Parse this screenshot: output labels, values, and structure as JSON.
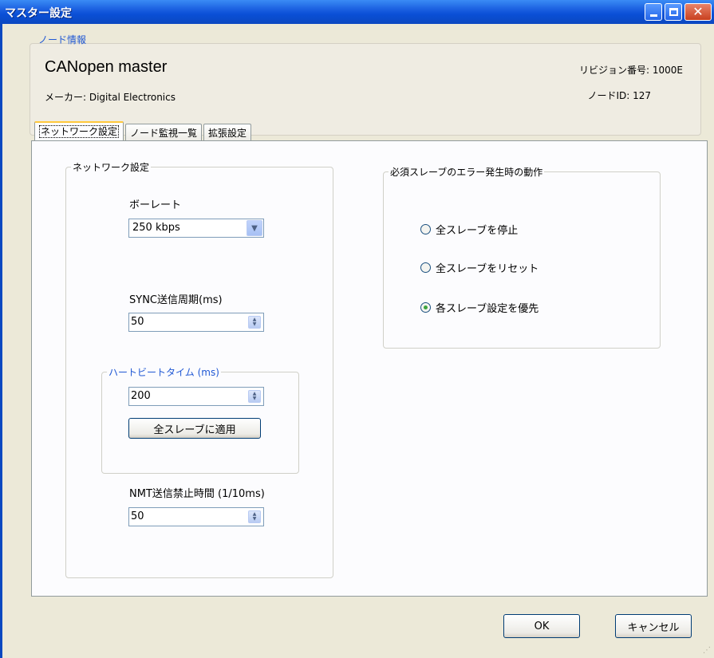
{
  "window": {
    "title": "マスター設定",
    "controls": {
      "minimize": "minimize-icon",
      "maximize": "maximize-icon",
      "close": "close-icon"
    }
  },
  "node_info": {
    "legend": "ノード情報",
    "device_name": "CANopen master",
    "maker": "メーカー: Digital Electronics",
    "revision": "リビジョン番号: 1000E",
    "node_id": "ノードID: 127"
  },
  "tabs": [
    {
      "label": "ネットワーク設定",
      "active": true
    },
    {
      "label": "ノード監視一覧",
      "active": false
    },
    {
      "label": "拡張設定",
      "active": false
    }
  ],
  "network": {
    "legend": "ネットワーク設定",
    "baudrate_label": "ボーレート",
    "baudrate_value": "250 kbps",
    "sync_label": "SYNC送信周期(ms)",
    "sync_value": "50",
    "heartbeat_legend": "ハートビートタイム (ms)",
    "heartbeat_value": "200",
    "apply_all_button": "全スレーブに適用",
    "nmt_label": "NMT送信禁止時間 (1/10ms)",
    "nmt_value": "50"
  },
  "error_action": {
    "legend": "必須スレーブのエラー発生時の動作",
    "options": [
      {
        "label": "全スレーブを停止",
        "selected": false
      },
      {
        "label": "全スレーブをリセット",
        "selected": false
      },
      {
        "label": "各スレーブ設定を優先",
        "selected": true
      }
    ]
  },
  "footer": {
    "ok": "OK",
    "cancel": "キャンセル"
  },
  "colors": {
    "titlebar": "#0b48c0",
    "legend_text": "#2058d4",
    "dialog_bg": "#ece9d8",
    "active_tab_accent": "#ffc83c"
  }
}
